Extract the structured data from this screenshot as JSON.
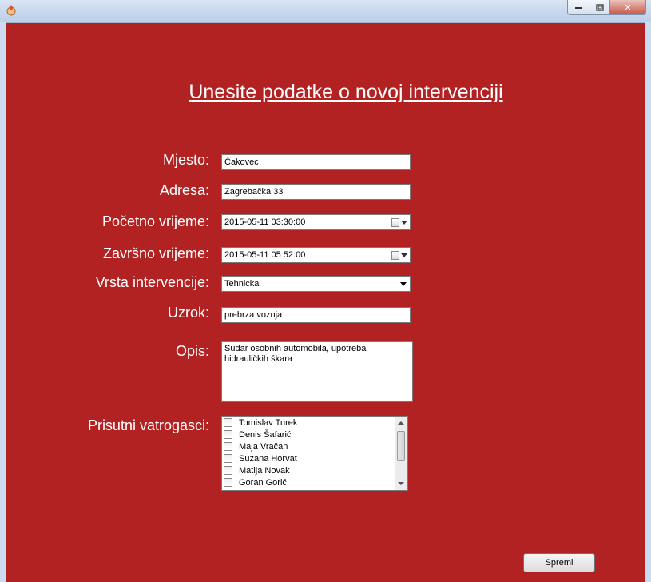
{
  "window": {
    "icon": "app-flame-icon",
    "controls": {
      "minimize_icon": "minimize-icon",
      "restore_icon": "restore-icon",
      "close_icon": "close-icon",
      "close_glyph": "✕"
    }
  },
  "form": {
    "title": "Unesite podatke o novoj intervenciji",
    "fields": {
      "mjesto": {
        "label": "Mjesto:",
        "value": "Čakovec"
      },
      "adresa": {
        "label": "Adresa:",
        "value": "Zagrebačka 33"
      },
      "pocetno": {
        "label": "Početno vrijeme:",
        "value": "2015-05-11 03:30:00"
      },
      "zavrsno": {
        "label": "Završno vrijeme:",
        "value": "2015-05-11 05:52:00"
      },
      "vrsta": {
        "label": "Vrsta intervencije:",
        "value": "Tehnicka"
      },
      "uzrok": {
        "label": "Uzrok:",
        "value": "prebrza voznja"
      },
      "opis": {
        "label": "Opis:",
        "value": "Sudar osobnih automobila, upotreba hidrauličkih škara"
      },
      "vatrogasci": {
        "label": "Prisutni vatrogasci:",
        "items": [
          "Tomislav Turek",
          "Denis Šafarić",
          "Maja Vračan",
          "Suzana Horvat",
          "Matija Novak",
          "Goran Gorić"
        ]
      }
    },
    "save_label": "Spremi"
  },
  "colors": {
    "background": "#b22222",
    "text": "#ffffff"
  }
}
